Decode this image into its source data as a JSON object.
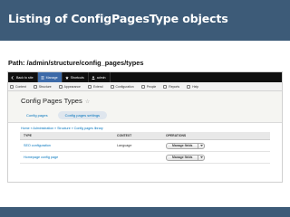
{
  "slide": {
    "title": "Listing of ConfigPagesType objects",
    "path": "Path: /admin/structure/config_pages/types"
  },
  "toolbar": {
    "items": [
      {
        "label": "Back to site",
        "icon": "back-arrow-icon"
      },
      {
        "label": "Manage",
        "icon": "menu-icon"
      },
      {
        "label": "Shortcuts",
        "icon": "star-icon"
      },
      {
        "label": "admin",
        "icon": "user-icon"
      }
    ]
  },
  "tray": {
    "items": [
      {
        "label": "Content",
        "icon": "content-icon"
      },
      {
        "label": "Structure",
        "icon": "structure-icon"
      },
      {
        "label": "Appearance",
        "icon": "appearance-icon"
      },
      {
        "label": "Extend",
        "icon": "extend-icon"
      },
      {
        "label": "Configuration",
        "icon": "wrench-icon"
      },
      {
        "label": "People",
        "icon": "people-icon"
      },
      {
        "label": "Reports",
        "icon": "reports-icon"
      },
      {
        "label": "Help",
        "icon": "help-icon"
      }
    ]
  },
  "page": {
    "title": "Config Pages Types",
    "star": "☆",
    "tabs": [
      {
        "label": "Config pages",
        "active": false
      },
      {
        "label": "Config pages settings",
        "active": true
      }
    ],
    "breadcrumb": "Home » Administration » Structure » Config pages library"
  },
  "table": {
    "headers": [
      "TYPE",
      "CONTEXT",
      "OPERATIONS"
    ],
    "rows": [
      {
        "type": "SEO configuration",
        "context": "Language",
        "operation": "Manage fields"
      },
      {
        "type": "Homepage config page",
        "context": "",
        "operation": "Manage fields"
      }
    ]
  },
  "colors": {
    "slide_bar": "#3d5b78",
    "toolbar_bg": "#0f0f0f",
    "toolbar_active": "#3d6aa8",
    "link": "#0074bd"
  }
}
